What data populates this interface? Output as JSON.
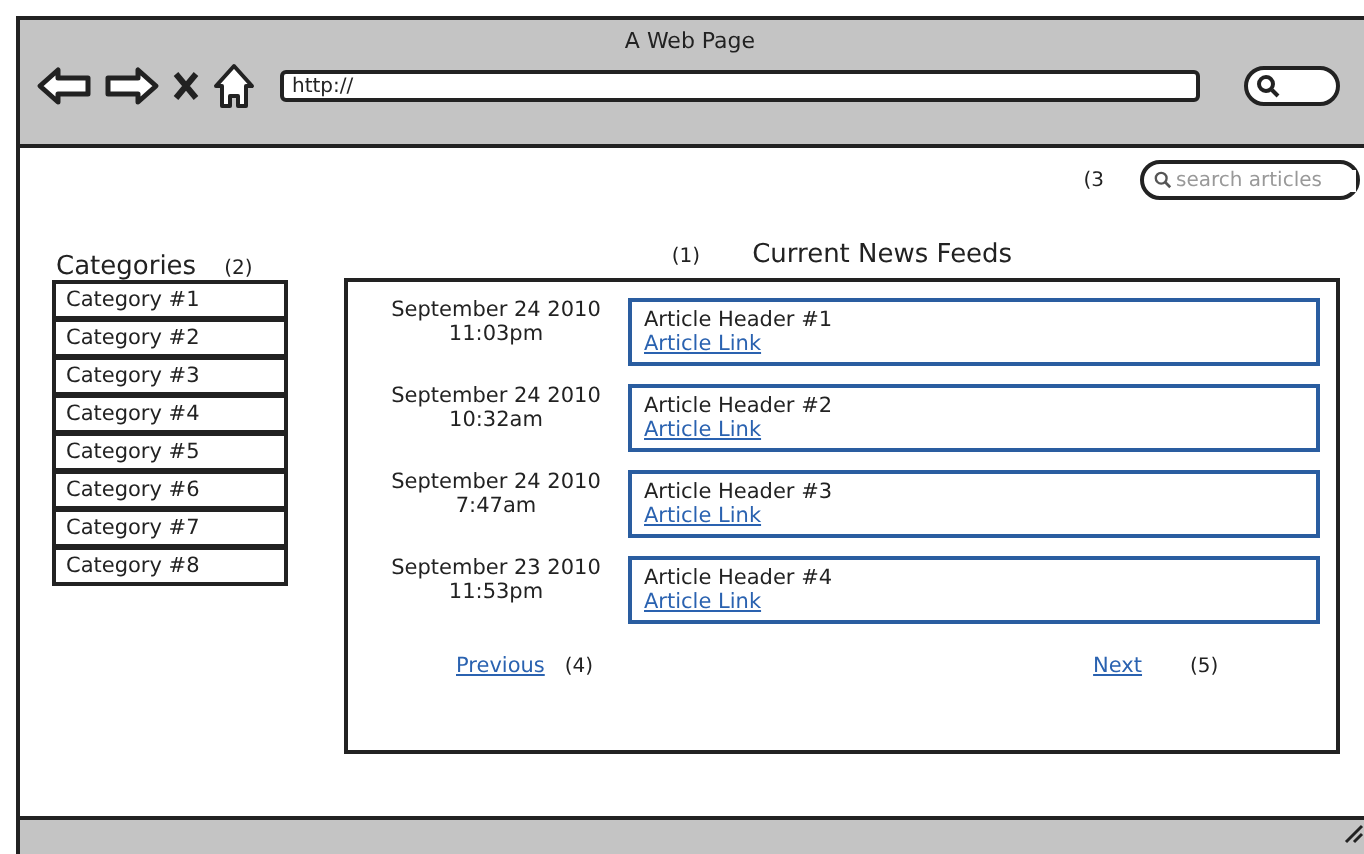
{
  "window": {
    "title": "A Web Page"
  },
  "address_bar": {
    "value": "http://"
  },
  "search": {
    "note": "(3",
    "placeholder": "search articles"
  },
  "categories": {
    "title": "Categories",
    "note": "(2)",
    "items": [
      {
        "label": "Category #1"
      },
      {
        "label": "Category #2"
      },
      {
        "label": "Category #3"
      },
      {
        "label": "Category #4"
      },
      {
        "label": "Category #5"
      },
      {
        "label": "Category #6"
      },
      {
        "label": "Category #7"
      },
      {
        "label": "Category #8"
      }
    ]
  },
  "feed": {
    "note": "(1)",
    "title": "Current News Feeds",
    "articles": [
      {
        "date": "September 24 2010",
        "time": "11:03pm",
        "header": "Article Header #1",
        "link": "Article Link"
      },
      {
        "date": "September 24 2010",
        "time": "10:32am",
        "header": "Article Header #2",
        "link": "Article Link"
      },
      {
        "date": "September 24 2010",
        "time": "7:47am",
        "header": "Article Header #3",
        "link": "Article Link"
      },
      {
        "date": "September 23 2010",
        "time": "11:53pm",
        "header": "Article Header #4",
        "link": "Article Link"
      }
    ],
    "previous": {
      "label": "Previous",
      "note": "(4)"
    },
    "next": {
      "label": "Next",
      "note": "(5)"
    }
  }
}
